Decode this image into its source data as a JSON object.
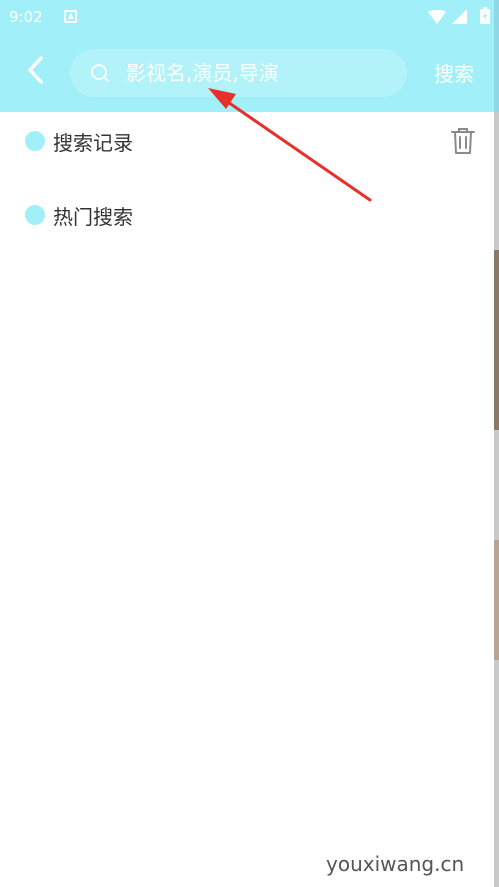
{
  "status_bar": {
    "time": "9:02"
  },
  "toolbar": {
    "search_placeholder": "影视名,演员,导演",
    "search_button_label": "搜索"
  },
  "sections": [
    {
      "label": "搜索记录",
      "has_clear": true
    },
    {
      "label": "热门搜索",
      "has_clear": false
    }
  ],
  "icons": {
    "back": "chevron-left-icon",
    "search": "search-icon",
    "clear_history": "trash-icon"
  },
  "colors": {
    "accent": "#a1eff8",
    "search_box": "#b2f3fa",
    "arrow": "#e8302a"
  },
  "watermark": "youxiwang.cn"
}
